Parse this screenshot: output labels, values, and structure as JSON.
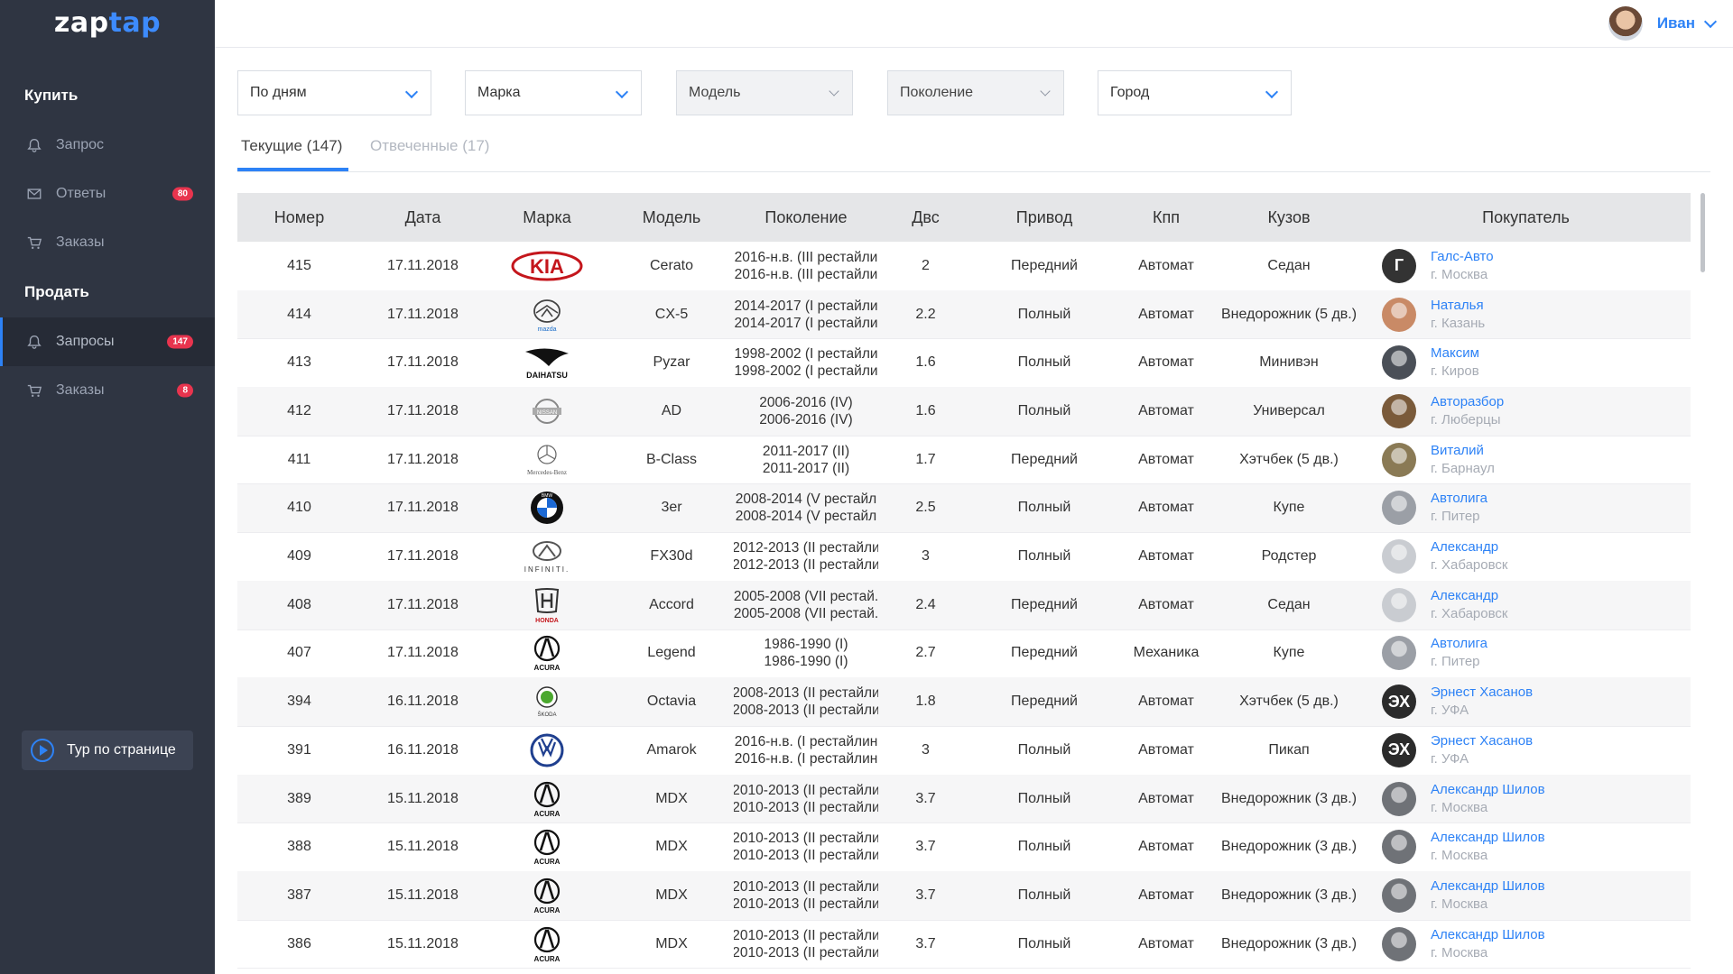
{
  "app": {
    "logo_main": "zap",
    "logo_accent": "tap"
  },
  "user": {
    "name": "Иван"
  },
  "sidebar": {
    "buy_title": "Купить",
    "sell_title": "Продать",
    "items": [
      {
        "label": "Запрос",
        "icon": "bell-icon",
        "badge": ""
      },
      {
        "label": "Ответы",
        "icon": "mail-icon",
        "badge": "80"
      },
      {
        "label": "Заказы",
        "icon": "cart-icon",
        "badge": ""
      },
      {
        "label": "Запросы",
        "icon": "bell-icon",
        "badge": "147"
      },
      {
        "label": "Заказы",
        "icon": "cart-icon",
        "badge": "8"
      }
    ],
    "tour_label": "Тур по странице"
  },
  "filters": [
    {
      "label": "По дням",
      "disabled": false
    },
    {
      "label": "Марка",
      "disabled": false
    },
    {
      "label": "Модель",
      "disabled": true
    },
    {
      "label": "Поколение",
      "disabled": true
    },
    {
      "label": "Город",
      "disabled": false
    }
  ],
  "tabs": [
    {
      "label": "Текущие (147)",
      "active": true
    },
    {
      "label": "Отвеченные (17)",
      "active": false
    }
  ],
  "table": {
    "headers": [
      "Номер",
      "Дата",
      "Марка",
      "Модель",
      "Поколение",
      "Двс",
      "Привод",
      "Кпп",
      "Кузов",
      "Покупатель"
    ],
    "rows": [
      {
        "num": "415",
        "date": "17.11.2018",
        "brand": "kia",
        "model": "Cerato",
        "gen1": "2016-н.в. (III рестайли",
        "gen2": "2016-н.в. (III рестайли",
        "engine": "2",
        "drive": "Передний",
        "gear": "Автомат",
        "body": "Седан",
        "buyer": "Галс-Авто",
        "city": "г. Москва",
        "av": "Г",
        "avc": "#333333"
      },
      {
        "num": "414",
        "date": "17.11.2018",
        "brand": "mazda",
        "model": "CX-5",
        "gen1": "2014-2017 (I рестайли",
        "gen2": "2014-2017 (I рестайли",
        "engine": "2.2",
        "drive": "Полный",
        "gear": "Автомат",
        "body": "Внедорожник (5 дв.)",
        "buyer": "Наталья",
        "city": "г. Казань",
        "av": "",
        "avc": "#c98a66"
      },
      {
        "num": "413",
        "date": "17.11.2018",
        "brand": "daihatsu",
        "model": "Pyzar",
        "gen1": "1998-2002 (I рестайли",
        "gen2": "1998-2002 (I рестайли",
        "engine": "1.6",
        "drive": "Полный",
        "gear": "Автомат",
        "body": "Минивэн",
        "buyer": "Максим",
        "city": "г. Киров",
        "av": "",
        "avc": "#4a4f57"
      },
      {
        "num": "412",
        "date": "17.11.2018",
        "brand": "nissan",
        "model": "AD",
        "gen1": "2006-2016 (IV)",
        "gen2": "2006-2016 (IV)",
        "engine": "1.6",
        "drive": "Полный",
        "gear": "Автомат",
        "body": "Универсал",
        "buyer": "Авторазбор",
        "city": "г. Люберцы",
        "av": "",
        "avc": "#7a5a3a"
      },
      {
        "num": "411",
        "date": "17.11.2018",
        "brand": "mercedes",
        "model": "B-Class",
        "gen1": "2011-2017 (II)",
        "gen2": "2011-2017 (II)",
        "engine": "1.7",
        "drive": "Передний",
        "gear": "Автомат",
        "body": "Хэтчбек (5 дв.)",
        "buyer": "Виталий",
        "city": "г. Барнаул",
        "av": "",
        "avc": "#8a7a55"
      },
      {
        "num": "410",
        "date": "17.11.2018",
        "brand": "bmw",
        "model": "3er",
        "gen1": "2008-2014 (V рестайл",
        "gen2": "2008-2014 (V рестайл",
        "engine": "2.5",
        "drive": "Полный",
        "gear": "Автомат",
        "body": "Купе",
        "buyer": "Автолига",
        "city": "г. Питер",
        "av": "",
        "avc": "#9b9fa6"
      },
      {
        "num": "409",
        "date": "17.11.2018",
        "brand": "infiniti",
        "model": "FX30d",
        "gen1": "2012-2013 (II рестайли",
        "gen2": "2012-2013 (II рестайли",
        "engine": "3",
        "drive": "Полный",
        "gear": "Автомат",
        "body": "Родстер",
        "buyer": "Александр",
        "city": "г. Хабаровск",
        "av": "",
        "avc": "#c9ccd1"
      },
      {
        "num": "408",
        "date": "17.11.2018",
        "brand": "honda",
        "model": "Accord",
        "gen1": "2005-2008 (VII рестай.",
        "gen2": "2005-2008 (VII рестай.",
        "engine": "2.4",
        "drive": "Передний",
        "gear": "Автомат",
        "body": "Седан",
        "buyer": "Александр",
        "city": "г. Хабаровск",
        "av": "",
        "avc": "#c9ccd1"
      },
      {
        "num": "407",
        "date": "17.11.2018",
        "brand": "acura",
        "model": "Legend",
        "gen1": "1986-1990 (I)",
        "gen2": "1986-1990 (I)",
        "engine": "2.7",
        "drive": "Передний",
        "gear": "Механика",
        "body": "Купе",
        "buyer": "Автолига",
        "city": "г. Питер",
        "av": "",
        "avc": "#9b9fa6"
      },
      {
        "num": "394",
        "date": "16.11.2018",
        "brand": "skoda",
        "model": "Octavia",
        "gen1": "2008-2013 (II рестайли",
        "gen2": "2008-2013 (II рестайли",
        "engine": "1.8",
        "drive": "Передний",
        "gear": "Автомат",
        "body": "Хэтчбек (5 дв.)",
        "buyer": "Эрнест Хасанов",
        "city": "г. УФА",
        "av": "ЭХ",
        "avc": "#2b2b2b"
      },
      {
        "num": "391",
        "date": "16.11.2018",
        "brand": "vw",
        "model": "Amarok",
        "gen1": "2016-н.в. (I рестайлин",
        "gen2": "2016-н.в. (I рестайлин",
        "engine": "3",
        "drive": "Полный",
        "gear": "Автомат",
        "body": "Пикап",
        "buyer": "Эрнест Хасанов",
        "city": "г. УФА",
        "av": "ЭХ",
        "avc": "#2b2b2b"
      },
      {
        "num": "389",
        "date": "15.11.2018",
        "brand": "acura",
        "model": "MDX",
        "gen1": "2010-2013 (II рестайли",
        "gen2": "2010-2013 (II рестайли",
        "engine": "3.7",
        "drive": "Полный",
        "gear": "Автомат",
        "body": "Внедорожник (3 дв.)",
        "buyer": "Александр Шилов",
        "city": "г. Москва",
        "av": "",
        "avc": "#6f7277"
      },
      {
        "num": "388",
        "date": "15.11.2018",
        "brand": "acura",
        "model": "MDX",
        "gen1": "2010-2013 (II рестайли",
        "gen2": "2010-2013 (II рестайли",
        "engine": "3.7",
        "drive": "Полный",
        "gear": "Автомат",
        "body": "Внедорожник (3 дв.)",
        "buyer": "Александр Шилов",
        "city": "г. Москва",
        "av": "",
        "avc": "#6f7277"
      },
      {
        "num": "387",
        "date": "15.11.2018",
        "brand": "acura",
        "model": "MDX",
        "gen1": "2010-2013 (II рестайли",
        "gen2": "2010-2013 (II рестайли",
        "engine": "3.7",
        "drive": "Полный",
        "gear": "Автомат",
        "body": "Внедорожник (3 дв.)",
        "buyer": "Александр Шилов",
        "city": "г. Москва",
        "av": "",
        "avc": "#6f7277"
      },
      {
        "num": "386",
        "date": "15.11.2018",
        "brand": "acura",
        "model": "MDX",
        "gen1": "2010-2013 (II рестайли",
        "gen2": "2010-2013 (II рестайли",
        "engine": "3.7",
        "drive": "Полный",
        "gear": "Автомат",
        "body": "Внедорожник (3 дв.)",
        "buyer": "Александр Шилов",
        "city": "г. Москва",
        "av": "",
        "avc": "#6f7277"
      }
    ]
  }
}
